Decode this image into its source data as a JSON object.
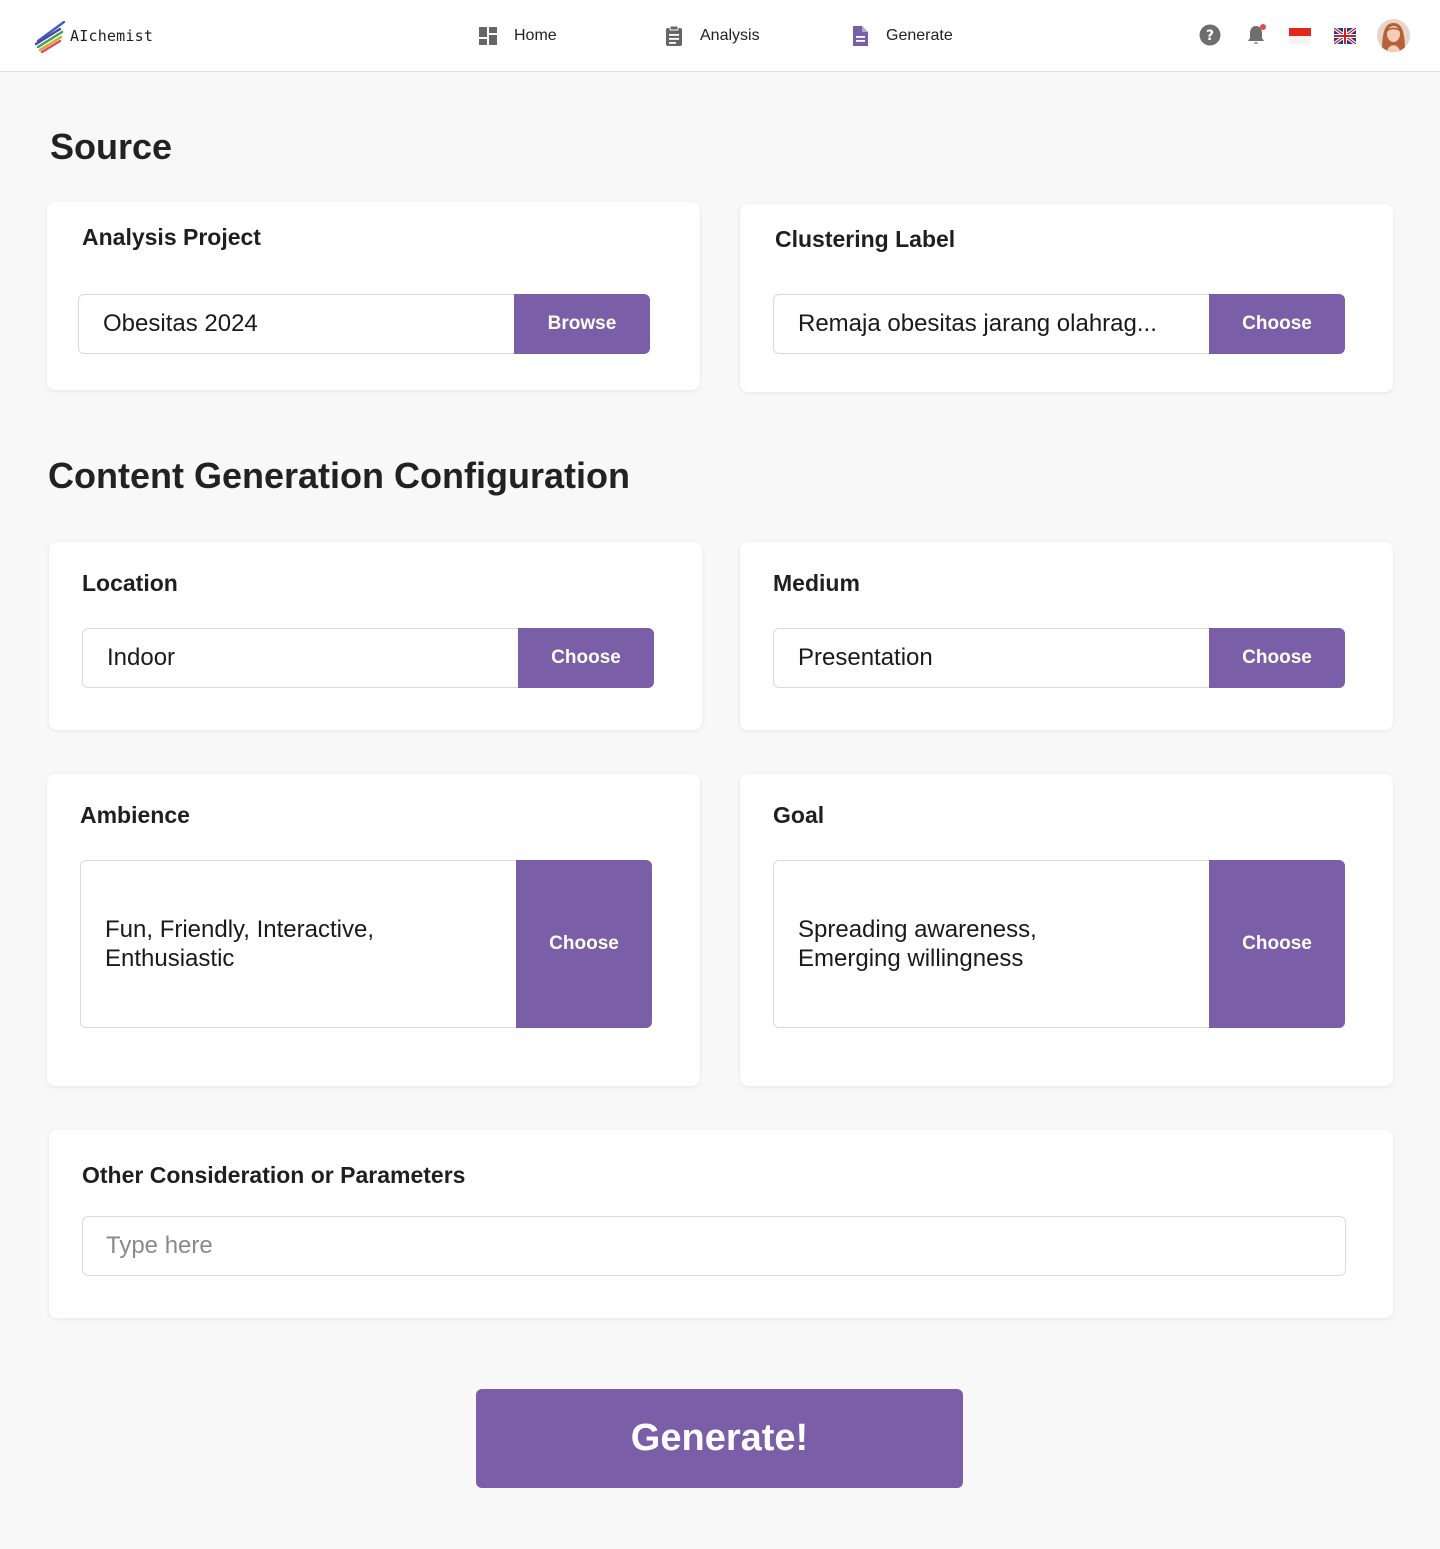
{
  "brand": {
    "name": "AIchemist"
  },
  "nav": {
    "home": {
      "label": "Home",
      "icon": "dashboard-icon"
    },
    "analysis": {
      "label": "Analysis",
      "icon": "clipboard-icon"
    },
    "generate": {
      "label": "Generate",
      "icon": "document-icon"
    }
  },
  "header_icons": [
    "help-icon",
    "bell-icon",
    "indonesia-flag-icon",
    "uk-flag-icon"
  ],
  "source": {
    "title": "Source",
    "analysis_project": {
      "label": "Analysis Project",
      "value": "Obesitas 2024",
      "button": "Browse"
    },
    "clustering_label": {
      "label": "Clustering Label",
      "value": "Remaja obesitas jarang olahrag...",
      "button": "Choose"
    }
  },
  "config": {
    "title": "Content Generation Configuration",
    "location": {
      "label": "Location",
      "value": "Indoor",
      "button": "Choose"
    },
    "medium": {
      "label": "Medium",
      "value": "Presentation",
      "button": "Choose"
    },
    "ambience": {
      "label": "Ambience",
      "value": "Fun, Friendly, Interactive, Enthusiastic",
      "button": "Choose"
    },
    "goal": {
      "label": "Goal",
      "value": "Spreading awareness, Emerging willingness",
      "button": "Choose"
    },
    "other": {
      "label": "Other Consideration or Parameters",
      "placeholder": "Type here"
    }
  },
  "generate_button": "Generate!",
  "colors": {
    "accent": "#7a5ea8",
    "active_nav": "#7a5ea8",
    "background": "#f8f8f8"
  }
}
